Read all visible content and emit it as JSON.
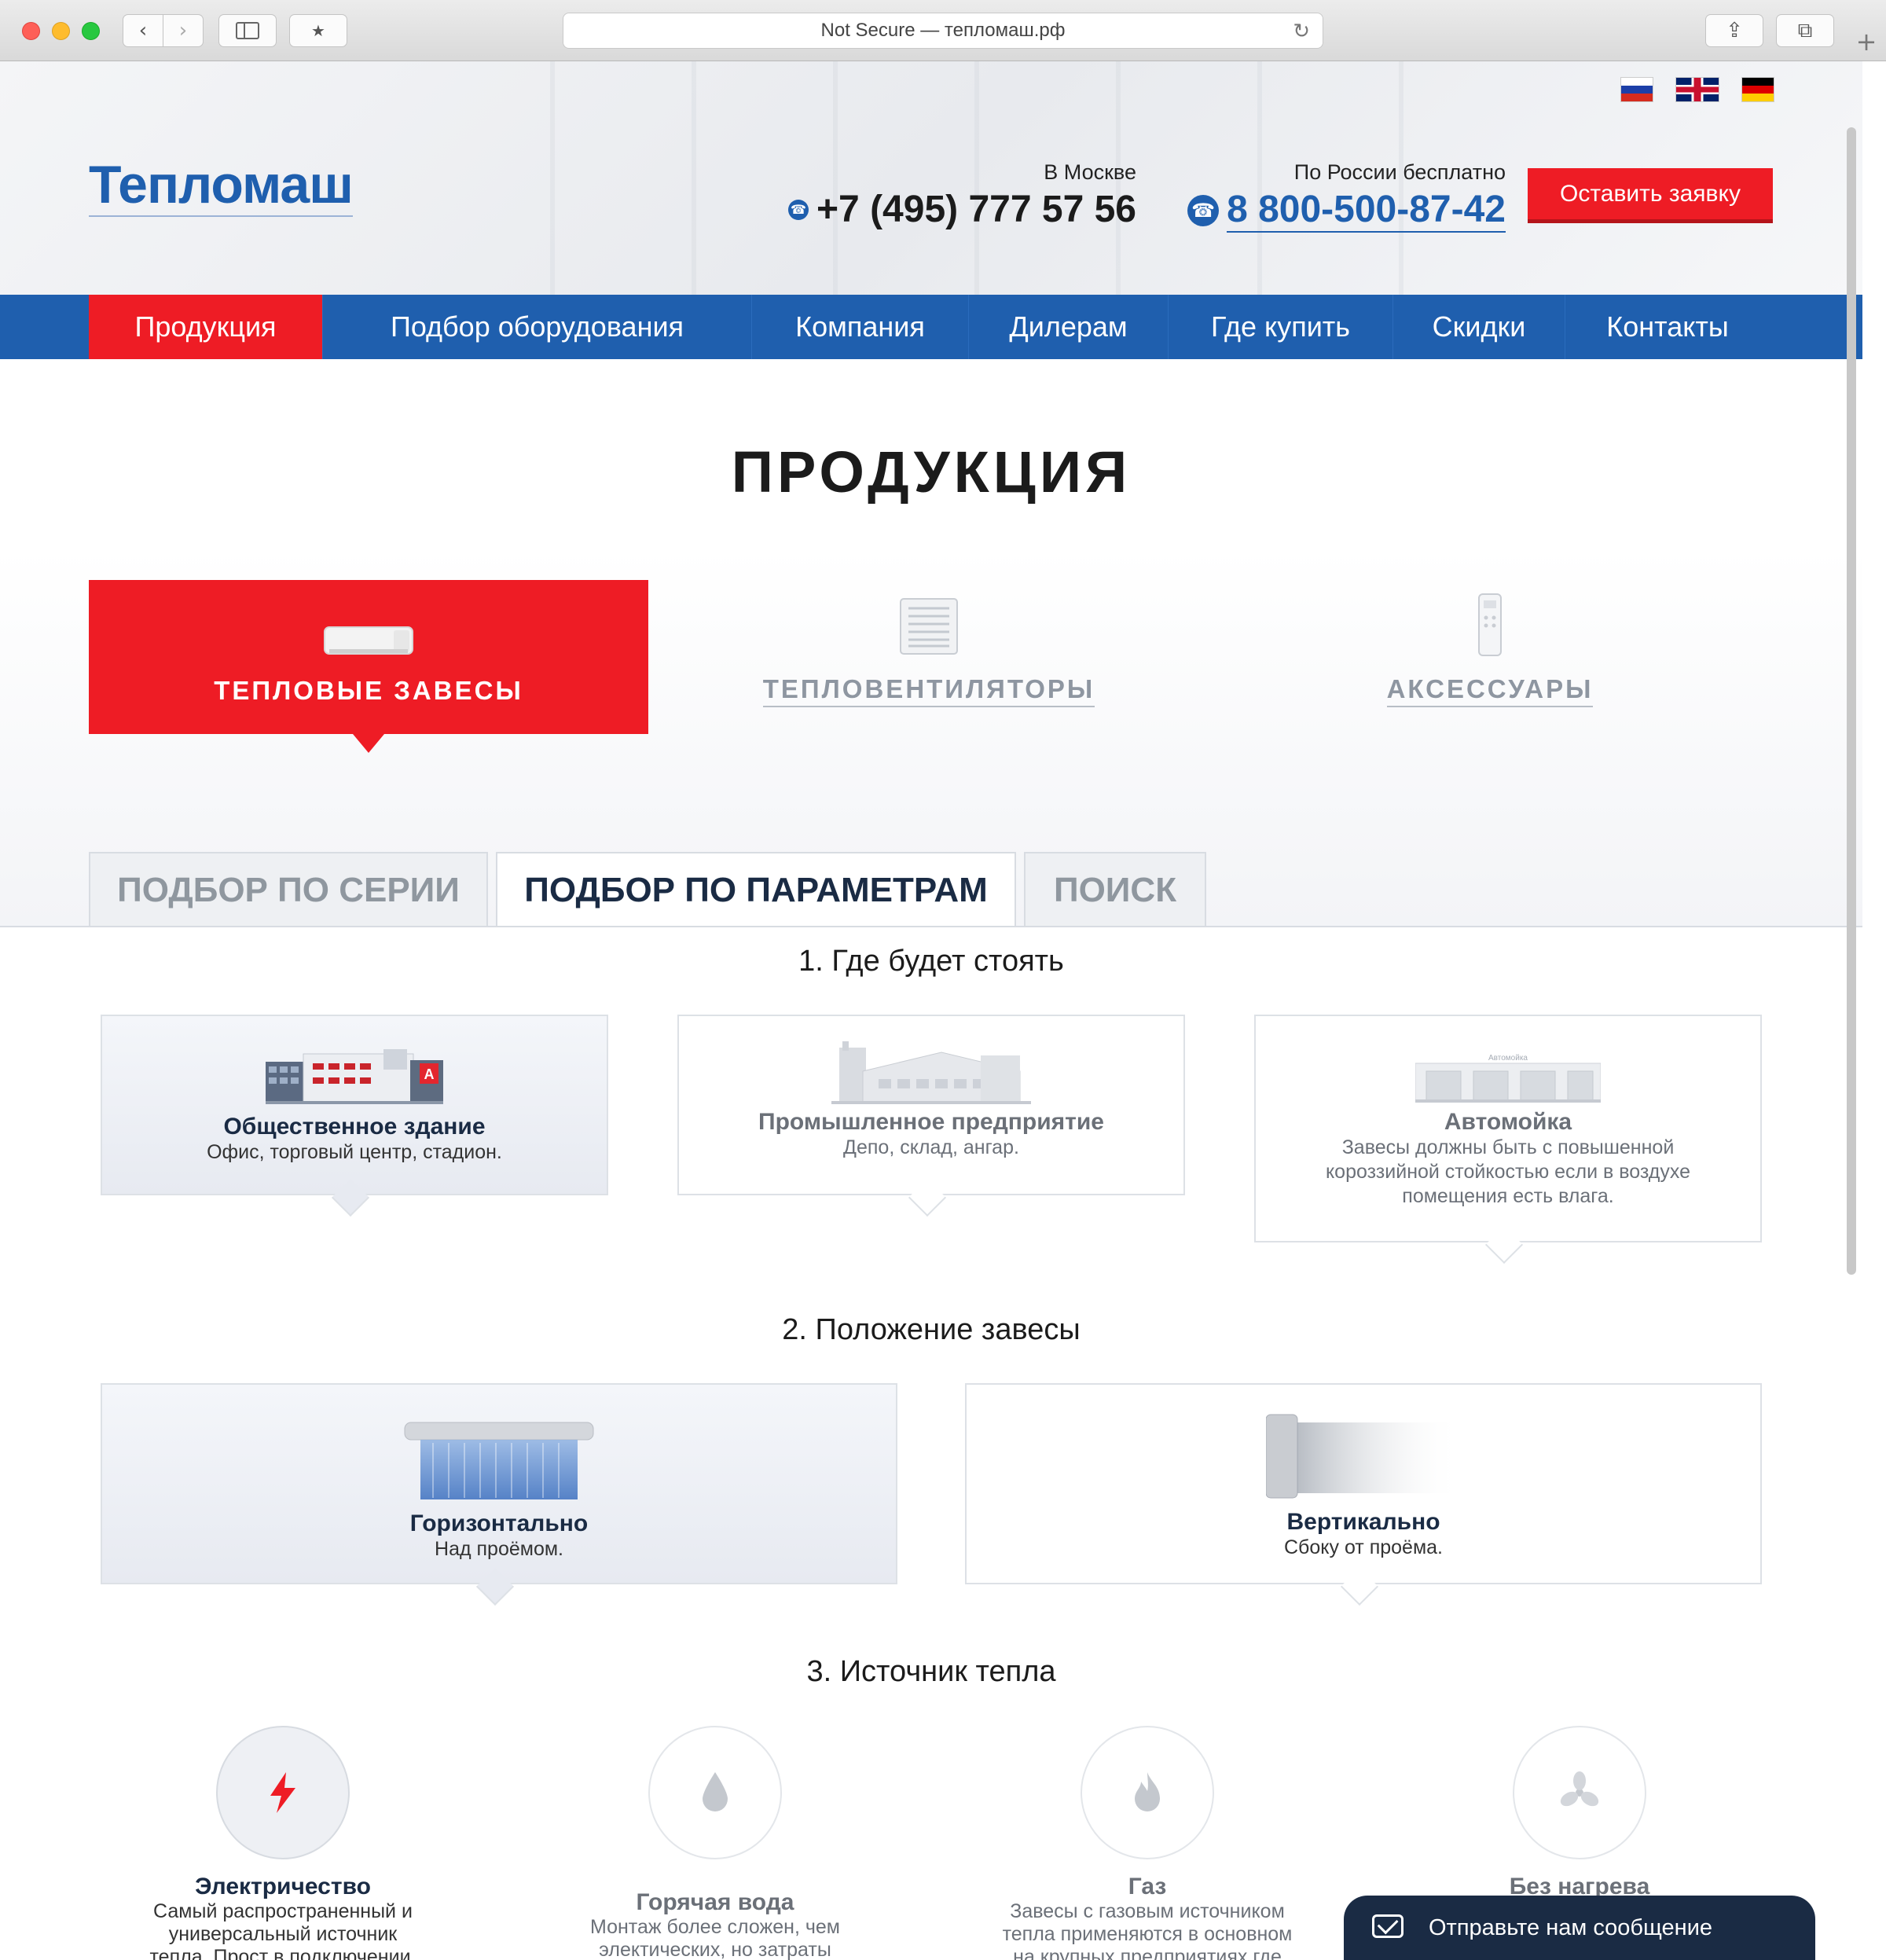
{
  "browser": {
    "url_text": "Not Secure — тепломаш.рф",
    "reload_icon": "↻",
    "newtab_icon": "+",
    "back_icon": "‹",
    "forward_icon": "›",
    "share_icon": "⇪",
    "tabs_icon": "⧉",
    "bookmark_icon": "★"
  },
  "header": {
    "logo": "Тепломаш",
    "moscow": {
      "label": "В Москве",
      "phone": "+7 (495) 777 57 56"
    },
    "russia": {
      "label": "По России бесплатно",
      "phone": "8 800-500-87-42"
    },
    "cta": "Оставить заявку",
    "languages": [
      "ru",
      "en",
      "de"
    ]
  },
  "nav": {
    "items": [
      {
        "label": "Продукция",
        "active": true
      },
      {
        "label": "Подбор оборудования"
      },
      {
        "label": "Компания"
      },
      {
        "label": "Дилерам"
      },
      {
        "label": "Где купить"
      },
      {
        "label": "Скидки"
      },
      {
        "label": "Контакты"
      }
    ]
  },
  "page_title": "ПРОДУКЦИЯ",
  "categories": [
    {
      "label": "ТЕПЛОВЫЕ ЗАВЕСЫ",
      "active": true
    },
    {
      "label": "ТЕПЛОВЕНТИЛЯТОРЫ"
    },
    {
      "label": "АКСЕССУАРЫ"
    }
  ],
  "tabs": [
    {
      "label": "ПОДБОР ПО СЕРИИ"
    },
    {
      "label": "ПОДБОР ПО ПАРАМЕТРАМ",
      "active": true
    },
    {
      "label": "ПОИСК"
    }
  ],
  "step1": {
    "title": "1. Где будет стоять",
    "options": [
      {
        "title": "Общественное здание",
        "desc": "Офис, торговый центр, стадион.",
        "active": true,
        "badge": "A"
      },
      {
        "title": "Промышленное предприятие",
        "desc": "Депо, склад, ангар."
      },
      {
        "title": "Автомойка",
        "desc": "Завесы должны быть с повышенной короззийной стойкостью если в воздухе помещения есть влага.",
        "sign": "Автомойка"
      }
    ]
  },
  "step2": {
    "title": "2. Положение завесы",
    "options": [
      {
        "title": "Горизонтально",
        "desc": "Над проёмом.",
        "active": true
      },
      {
        "title": "Вертикально",
        "desc": "Сбоку от проёма."
      }
    ]
  },
  "step3": {
    "title": "3. Источник тепла",
    "options": [
      {
        "title": "Электричество",
        "desc": "Самый распространенный и универсальный источник тепла. Прост в подключении. Больше",
        "icon": "lightning-icon",
        "active": true
      },
      {
        "title": "Горячая вода",
        "desc": "Монтаж более сложен, чем электических, но затраты меньше, а",
        "icon": "water-drop-icon"
      },
      {
        "title": "Газ",
        "desc": "Завесы с газовым источником тепла применяются в основном на крупных предприятиях где требуется",
        "icon": "flame-icon"
      },
      {
        "title": "Без нагрева",
        "desc": "",
        "icon": "fan-icon"
      }
    ]
  },
  "chat": {
    "label": "Отправьте нам сообщение"
  },
  "colors": {
    "brand_blue": "#1f5fae",
    "brand_red": "#ee1c25",
    "dark_navy": "#1a2b44"
  }
}
